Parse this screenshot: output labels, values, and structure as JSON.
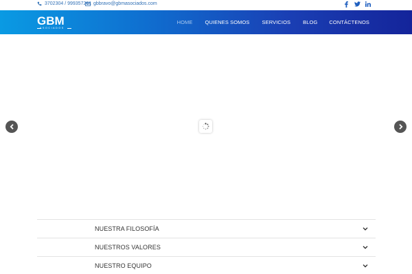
{
  "topbar": {
    "phone": "3702304 / 999357281",
    "email": "gbbravo@gbmasociados.com",
    "social": [
      {
        "icon": "facebook-icon",
        "label": "f"
      },
      {
        "icon": "twitter-icon",
        "label": "t"
      },
      {
        "icon": "linkedin-icon",
        "label": "in"
      }
    ]
  },
  "logo": {
    "main": "GBM",
    "sub": "ASOCIADOS"
  },
  "nav": {
    "items": [
      {
        "label": "HOME",
        "active": true
      },
      {
        "label": "QUIENES SOMOS",
        "active": false
      },
      {
        "label": "SERVICIOS",
        "active": false
      },
      {
        "label": "BLOG",
        "active": false
      },
      {
        "label": "CONTÁCTENOS",
        "active": false
      }
    ]
  },
  "slider": {
    "prev_icon": "chevron-left-icon",
    "next_icon": "chevron-right-icon",
    "loader_icon": "spinner-icon"
  },
  "accordion": {
    "items": [
      {
        "title": "NUESTRA FILOSOFÍA"
      },
      {
        "title": "NUESTROS VALORES"
      },
      {
        "title": "NUESTRO EQUIPO"
      }
    ]
  },
  "colors": {
    "header_start": "#0a9ae3",
    "header_end": "#14249a",
    "link": "#2f6fb5",
    "arrow_bg": "#555555"
  }
}
